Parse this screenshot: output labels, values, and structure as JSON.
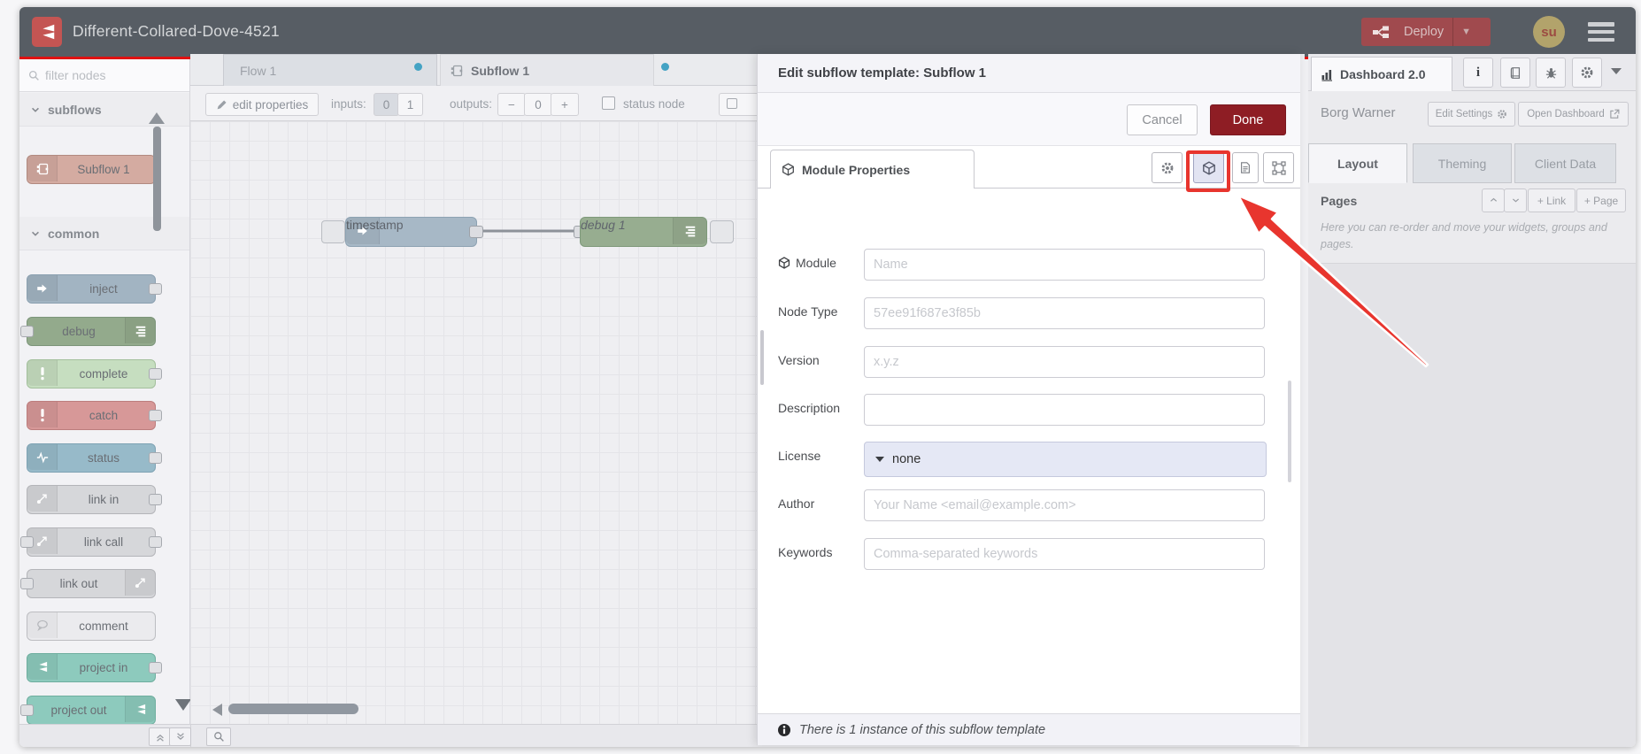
{
  "header": {
    "title": "Different-Collared-Dove-4521",
    "deploy": "Deploy",
    "avatar": "su"
  },
  "palette": {
    "filter_placeholder": "filter nodes",
    "sections": [
      {
        "label": "subflows",
        "items": [
          {
            "label": "Subflow 1"
          }
        ]
      },
      {
        "label": "common",
        "items": [
          {
            "label": "inject"
          },
          {
            "label": "debug"
          },
          {
            "label": "complete"
          },
          {
            "label": "catch"
          },
          {
            "label": "status"
          },
          {
            "label": "link in"
          },
          {
            "label": "link call"
          },
          {
            "label": "link out"
          },
          {
            "label": "comment"
          },
          {
            "label": "project in"
          },
          {
            "label": "project out"
          }
        ]
      }
    ]
  },
  "workspace": {
    "tabs": [
      {
        "label": "Flow 1"
      },
      {
        "label": "Subflow 1"
      }
    ],
    "toolbar": {
      "edit_properties": "edit properties",
      "inputs_label": "inputs:",
      "input_zero": "0",
      "input_one": "1",
      "outputs_label": "outputs:",
      "minus": "−",
      "outputs_value": "0",
      "plus": "+",
      "status_node_label": "status node"
    },
    "nodes": [
      {
        "label": "timestamp"
      },
      {
        "label": "debug 1"
      }
    ]
  },
  "tray": {
    "title": "Edit subflow template: Subflow 1",
    "cancel": "Cancel",
    "done": "Done",
    "tab_label": "Module Properties",
    "fields": {
      "module": {
        "label": "Module",
        "placeholder": "Name"
      },
      "node_type": {
        "label": "Node Type",
        "placeholder": "57ee91f687e3f85b"
      },
      "version": {
        "label": "Version",
        "placeholder": "x.y.z"
      },
      "description": {
        "label": "Description",
        "placeholder": ""
      },
      "license": {
        "label": "License",
        "value": "none"
      },
      "author": {
        "label": "Author",
        "placeholder": "Your Name <email@example.com>"
      },
      "keywords": {
        "label": "Keywords",
        "placeholder": "Comma-separated keywords"
      }
    },
    "footer": "There is 1 instance of this subflow template"
  },
  "sidebar": {
    "tab": "Dashboard 2.0",
    "project_name": "Borg Warner",
    "edit_settings": "Edit Settings",
    "open_dashboard": "Open Dashboard",
    "tabs": [
      {
        "label": "Layout"
      },
      {
        "label": "Theming"
      },
      {
        "label": "Client Data"
      }
    ],
    "pages_title": "Pages",
    "add_link": "+ Link",
    "add_page": "+ Page",
    "pages_help": "Here you can re-order and move your widgets, groups and pages."
  },
  "colors": {
    "header": "#575d64",
    "deploy_red": "#a04a4e",
    "done_red": "#8e1d24",
    "accent_red_line": "#e01212",
    "unsaved_dot": "#44a3c4",
    "annotation": "#e8352e"
  }
}
